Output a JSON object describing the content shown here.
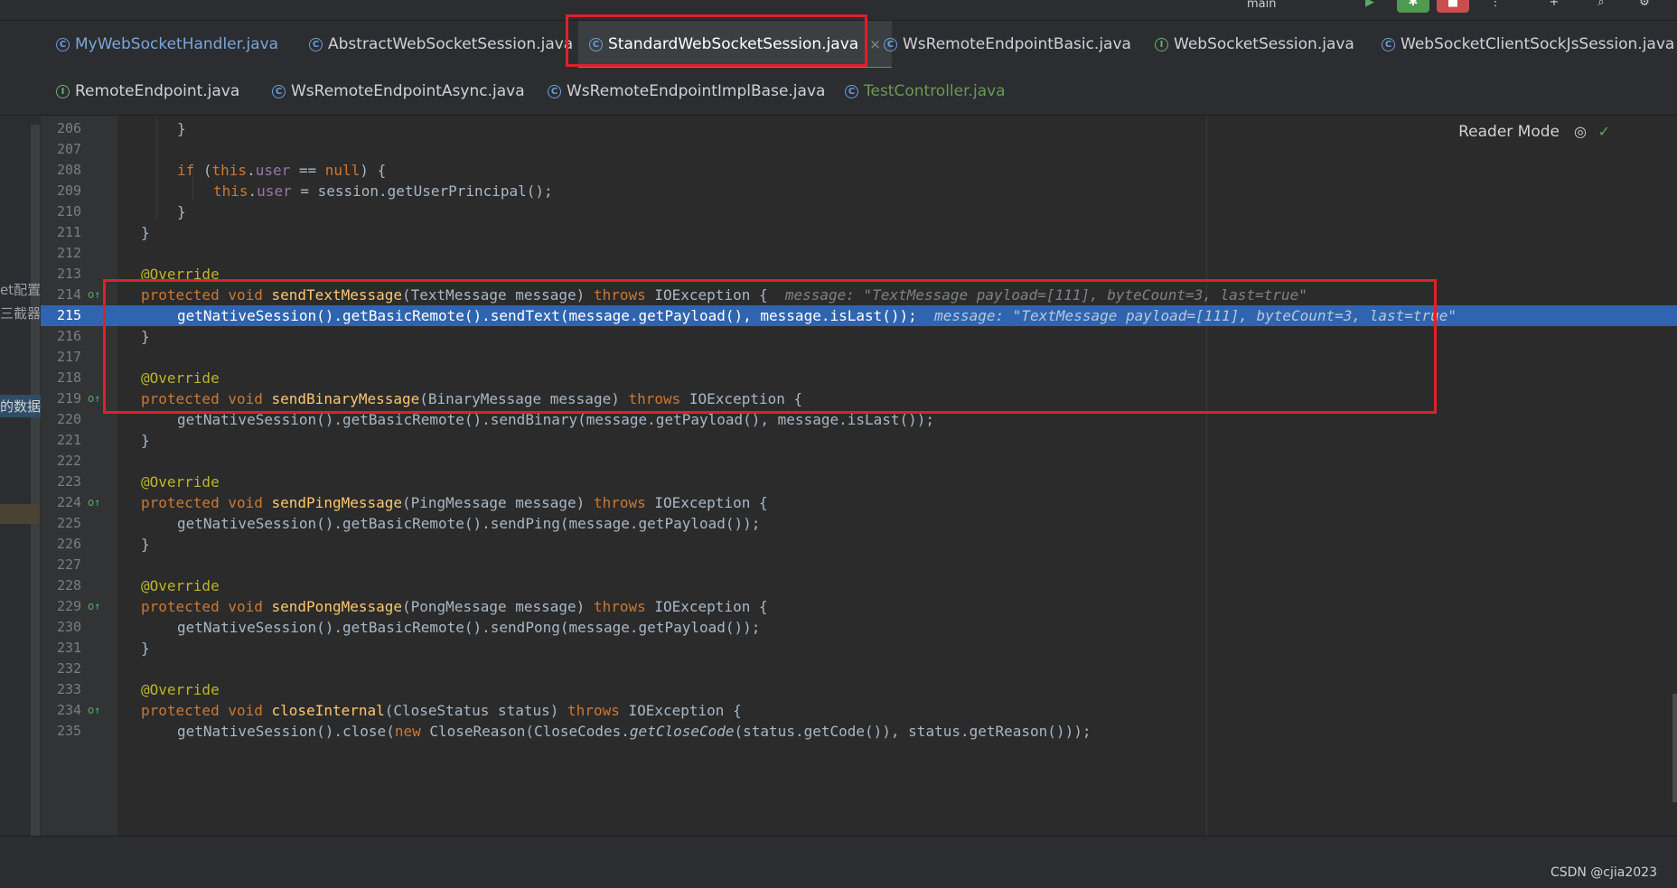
{
  "toolbar": {
    "branch_label": "main",
    "icons": [
      "run-icon",
      "debug-icon",
      "stop-icon",
      "more-icon",
      "add-icon",
      "search-icon",
      "gear-icon"
    ],
    "debug_color": "#4e9a4e",
    "stop_color": "#c94f4f"
  },
  "tabs_row1": [
    {
      "label": "MyWebSocketHandler.java",
      "icon": "class-icon"
    },
    {
      "label": "AbstractWebSocketSession.java",
      "icon": "class-icon"
    },
    {
      "label": "StandardWebSocketSession.java",
      "icon": "class-icon",
      "active": true,
      "close": "×"
    },
    {
      "label": "WsRemoteEndpointBasic.java",
      "icon": "class-icon"
    },
    {
      "label": "WebSocketSession.java",
      "icon": "interface-icon"
    },
    {
      "label": "WebSocketClientSockJsSession.java",
      "icon": "class-icon"
    }
  ],
  "tabs_row2": [
    {
      "label": "RemoteEndpoint.java",
      "icon": "interface-icon"
    },
    {
      "label": "WsRemoteEndpointAsync.java",
      "icon": "class-icon"
    },
    {
      "label": "WsRemoteEndpointImplBase.java",
      "icon": "class-icon"
    },
    {
      "label": "TestController.java",
      "icon": "class-icon"
    }
  ],
  "left_panel": {
    "item1": "et配置",
    "item2": "三截器",
    "item3": "的数据发"
  },
  "editor": {
    "reader_mode_label": "Reader Mode",
    "current_line": "215",
    "lines": [
      {
        "n": "206",
        "code": "}"
      },
      {
        "n": "207",
        "code": ""
      },
      {
        "n": "208",
        "code": "if (this.user == null) {"
      },
      {
        "n": "209",
        "code": "this.user = session.getUserPrincipal();"
      },
      {
        "n": "210",
        "code": "}"
      },
      {
        "n": "211",
        "code": "}"
      },
      {
        "n": "212",
        "code": ""
      },
      {
        "n": "213",
        "code": "@Override"
      },
      {
        "n": "214",
        "code": "protected void sendTextMessage(TextMessage message) throws IOException {",
        "hint": "message: \"TextMessage payload=[111], byteCount=3, last=true\""
      },
      {
        "n": "215",
        "code": "getNativeSession().getBasicRemote().sendText(message.getPayload(), message.isLast());",
        "hint": "message: \"TextMessage payload=[111], byteCount=3, last=true\""
      },
      {
        "n": "216",
        "code": "}"
      },
      {
        "n": "217",
        "code": ""
      },
      {
        "n": "218",
        "code": "@Override"
      },
      {
        "n": "219",
        "code": "protected void sendBinaryMessage(BinaryMessage message) throws IOException {"
      },
      {
        "n": "220",
        "code": "getNativeSession().getBasicRemote().sendBinary(message.getPayload(), message.isLast());"
      },
      {
        "n": "221",
        "code": "}"
      },
      {
        "n": "222",
        "code": ""
      },
      {
        "n": "223",
        "code": "@Override"
      },
      {
        "n": "224",
        "code": "protected void sendPingMessage(PingMessage message) throws IOException {"
      },
      {
        "n": "225",
        "code": "getNativeSession().getBasicRemote().sendPing(message.getPayload());"
      },
      {
        "n": "226",
        "code": "}"
      },
      {
        "n": "227",
        "code": ""
      },
      {
        "n": "228",
        "code": "@Override"
      },
      {
        "n": "229",
        "code": "protected void sendPongMessage(PongMessage message) throws IOException {"
      },
      {
        "n": "230",
        "code": "getNativeSession().getBasicRemote().sendPong(message.getPayload());"
      },
      {
        "n": "231",
        "code": "}"
      },
      {
        "n": "232",
        "code": ""
      },
      {
        "n": "233",
        "code": "@Override"
      },
      {
        "n": "234",
        "code": "protected void closeInternal(CloseStatus status) throws IOException {"
      },
      {
        "n": "235",
        "code": "getNativeSession().close(new CloseReason(CloseCodes.getCloseCode(status.getCode()), status.getReason()));"
      }
    ],
    "override_marker": "o↑"
  },
  "annotations": {
    "box_color": "#e0202a"
  },
  "status": {
    "watermark": "CSDN @cjia2023"
  }
}
